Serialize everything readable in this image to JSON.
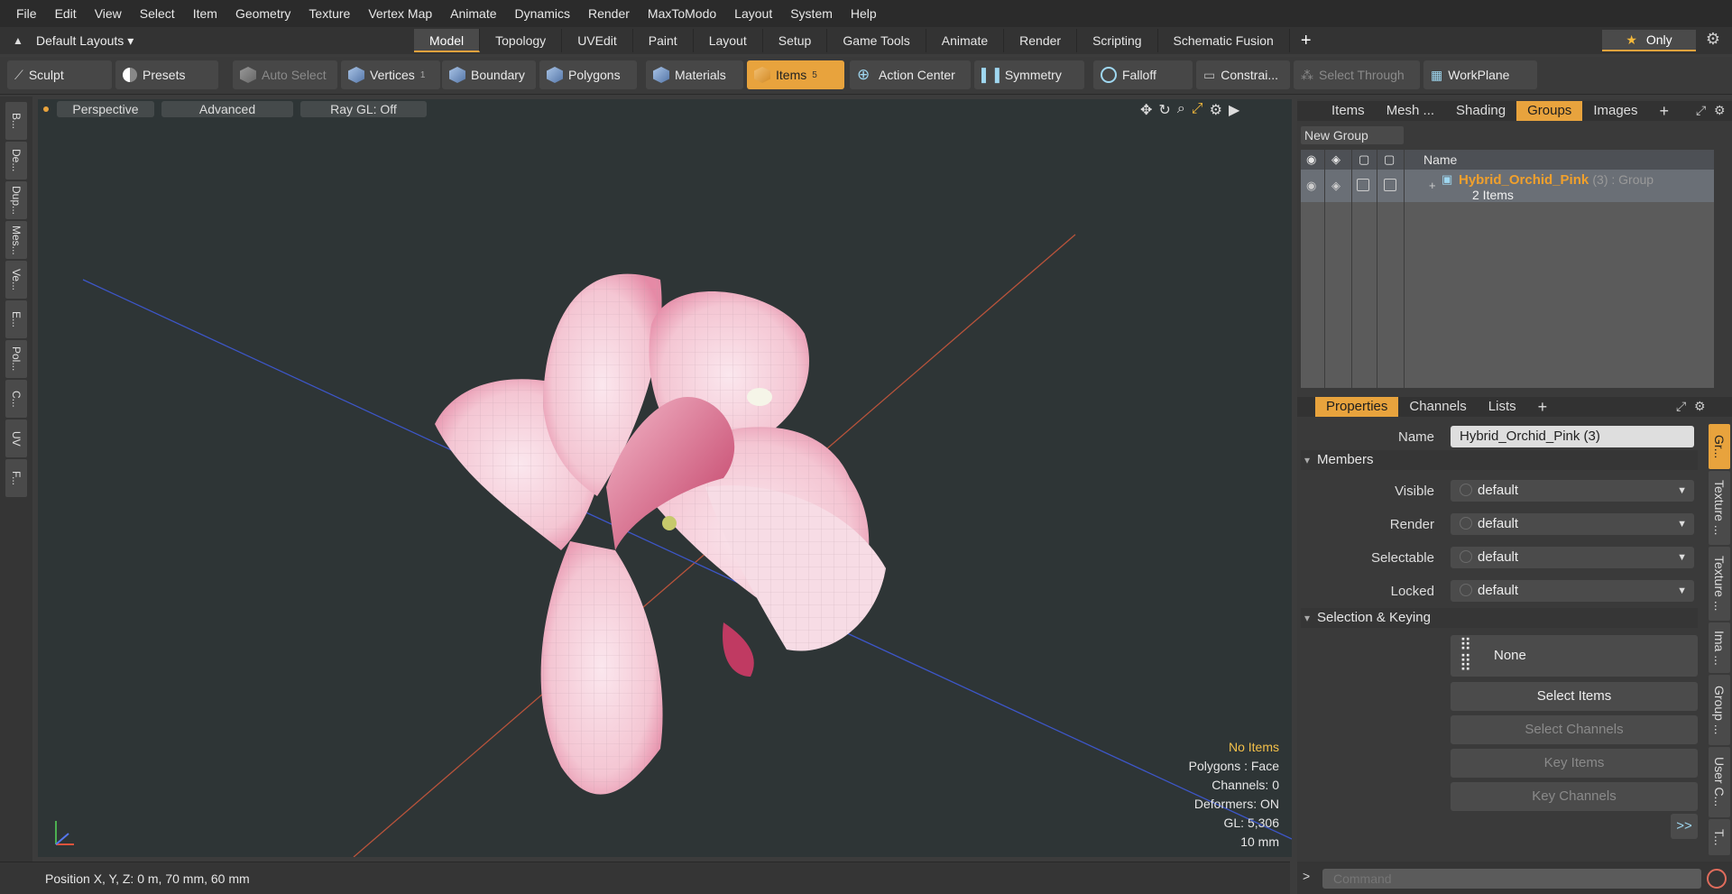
{
  "menubar": [
    "File",
    "Edit",
    "View",
    "Select",
    "Item",
    "Geometry",
    "Texture",
    "Vertex Map",
    "Animate",
    "Dynamics",
    "Render",
    "MaxToModo",
    "Layout",
    "System",
    "Help"
  ],
  "layoutbar": {
    "layouts_label": "Default Layouts",
    "tabs": [
      "Model",
      "Topology",
      "UVEdit",
      "Paint",
      "Layout",
      "Setup",
      "Game Tools",
      "Animate",
      "Render",
      "Scripting",
      "Schematic Fusion"
    ],
    "active_tab": "Model",
    "plus": "+",
    "only_label": "Only"
  },
  "toolbar": {
    "sculpt": "Sculpt",
    "presets": "Presets",
    "auto_select": "Auto Select",
    "vertices": "Vertices",
    "vertices_count": "1",
    "boundary": "Boundary",
    "polygons": "Polygons",
    "materials": "Materials",
    "items": "Items",
    "items_count": "5",
    "action_center": "Action Center",
    "symmetry": "Symmetry",
    "falloff": "Falloff",
    "constraints": "Constrai...",
    "select_through": "Select Through",
    "workplane": "WorkPlane"
  },
  "left_tabs": [
    "B...",
    "De...",
    "Dup...",
    "Mes...",
    "Ve...",
    "E...",
    "Pol...",
    "C...",
    "UV",
    "F..."
  ],
  "viewport": {
    "view_mode": "Perspective",
    "shading": "Advanced",
    "raygl": "Ray GL: Off",
    "hud": {
      "selection": "No Items",
      "polygons": "Polygons : Face",
      "channels": "Channels: 0",
      "deformers": "Deformers: ON",
      "gl": "GL: 5,306",
      "grid": "10 mm"
    }
  },
  "groups_panel": {
    "tabs": [
      "Items",
      "Mesh ...",
      "Shading",
      "Groups",
      "Images"
    ],
    "active_tab": "Groups",
    "new_group": "New Group",
    "column_name": "Name",
    "group": {
      "name": "Hybrid_Orchid_Pink",
      "suffix": "(3) : Group",
      "count": "2 Items"
    }
  },
  "properties_panel": {
    "tabs": [
      "Properties",
      "Channels",
      "Lists"
    ],
    "active_tab": "Properties",
    "name_label": "Name",
    "name_value": "Hybrid_Orchid_Pink (3)",
    "members_section": "Members",
    "visible_label": "Visible",
    "visible_value": "default",
    "render_label": "Render",
    "render_value": "default",
    "selectable_label": "Selectable",
    "selectable_value": "default",
    "locked_label": "Locked",
    "locked_value": "default",
    "selection_section": "Selection & Keying",
    "none_label": "None",
    "select_items": "Select Items",
    "select_channels": "Select Channels",
    "key_items": "Key Items",
    "key_channels": "Key Channels",
    "more": ">>",
    "side_tabs": [
      "Gr...",
      "Texture ...",
      "Texture ...",
      "Ima ...",
      "Group ...",
      "User C...",
      "T..."
    ]
  },
  "status": {
    "position": "Position X, Y, Z:   0 m, 70 mm, 60 mm",
    "command_placeholder": "Command"
  },
  "colors": {
    "accent": "#e8a33d",
    "group_name": "#f0a02c",
    "viewport_bg": "#2e3536"
  }
}
